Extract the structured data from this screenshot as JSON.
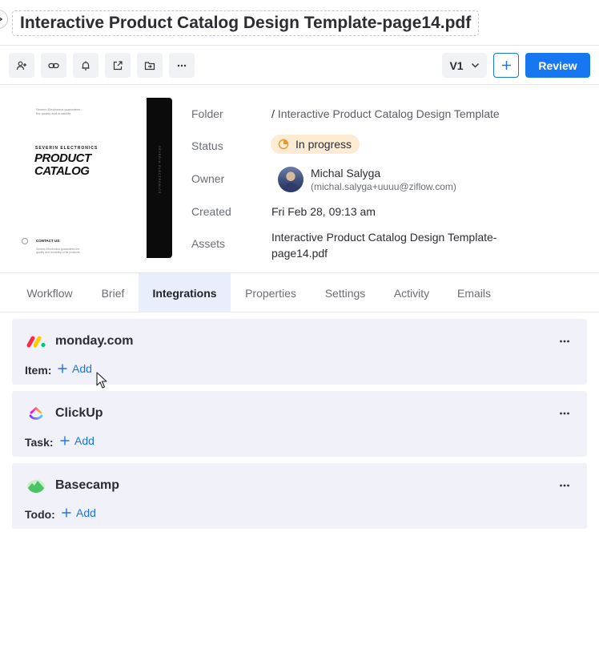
{
  "title": "Interactive Product Catalog Design Template-page14.pdf",
  "toolbar": {
    "icons": [
      "add-user-icon",
      "link-icon",
      "bell-icon",
      "share-icon",
      "move-to-folder-icon",
      "more-icon"
    ],
    "version_label": "V1",
    "review_label": "Review"
  },
  "thumbnail": {
    "small_text": "Severin Electronics guarantees the quality and durability.",
    "brand": "SEVERIN ELECTRONICS",
    "headline": "PRODUCT CATALOG",
    "contact": "CONTACT US:",
    "contact_sub": "Severin Electronics guarantees the quality and durability of its products."
  },
  "meta": {
    "folder_label": "Folder",
    "folder_slash": "/",
    "folder_value": "Interactive Product Catalog Design Template",
    "status_label": "Status",
    "status_value": "In progress",
    "status_color": "#fdebd3",
    "owner_label": "Owner",
    "owner_name": "Michal Salyga",
    "owner_email": "(michal.salyga+uuuu@ziflow.com)",
    "created_label": "Created",
    "created_value": "Fri Feb 28, 09:13 am",
    "assets_label": "Assets",
    "assets_value": "Interactive Product Catalog Design Template-page14.pdf"
  },
  "tabs": [
    {
      "label": "Workflow",
      "active": false
    },
    {
      "label": "Brief",
      "active": false
    },
    {
      "label": "Integrations",
      "active": true
    },
    {
      "label": "Properties",
      "active": false
    },
    {
      "label": "Settings",
      "active": false
    },
    {
      "label": "Activity",
      "active": false
    },
    {
      "label": "Emails",
      "active": false
    }
  ],
  "integrations": [
    {
      "name": "monday.com",
      "field_label": "Item:",
      "add_label": "Add",
      "logo": "monday-logo"
    },
    {
      "name": "ClickUp",
      "field_label": "Task:",
      "add_label": "Add",
      "logo": "clickup-logo"
    },
    {
      "name": "Basecamp",
      "field_label": "Todo:",
      "add_label": "Add",
      "logo": "basecamp-logo"
    }
  ],
  "colors": {
    "accent": "#1677f0",
    "active_tab_bg": "#e8eefb",
    "card_bg": "#f1f1f9"
  }
}
